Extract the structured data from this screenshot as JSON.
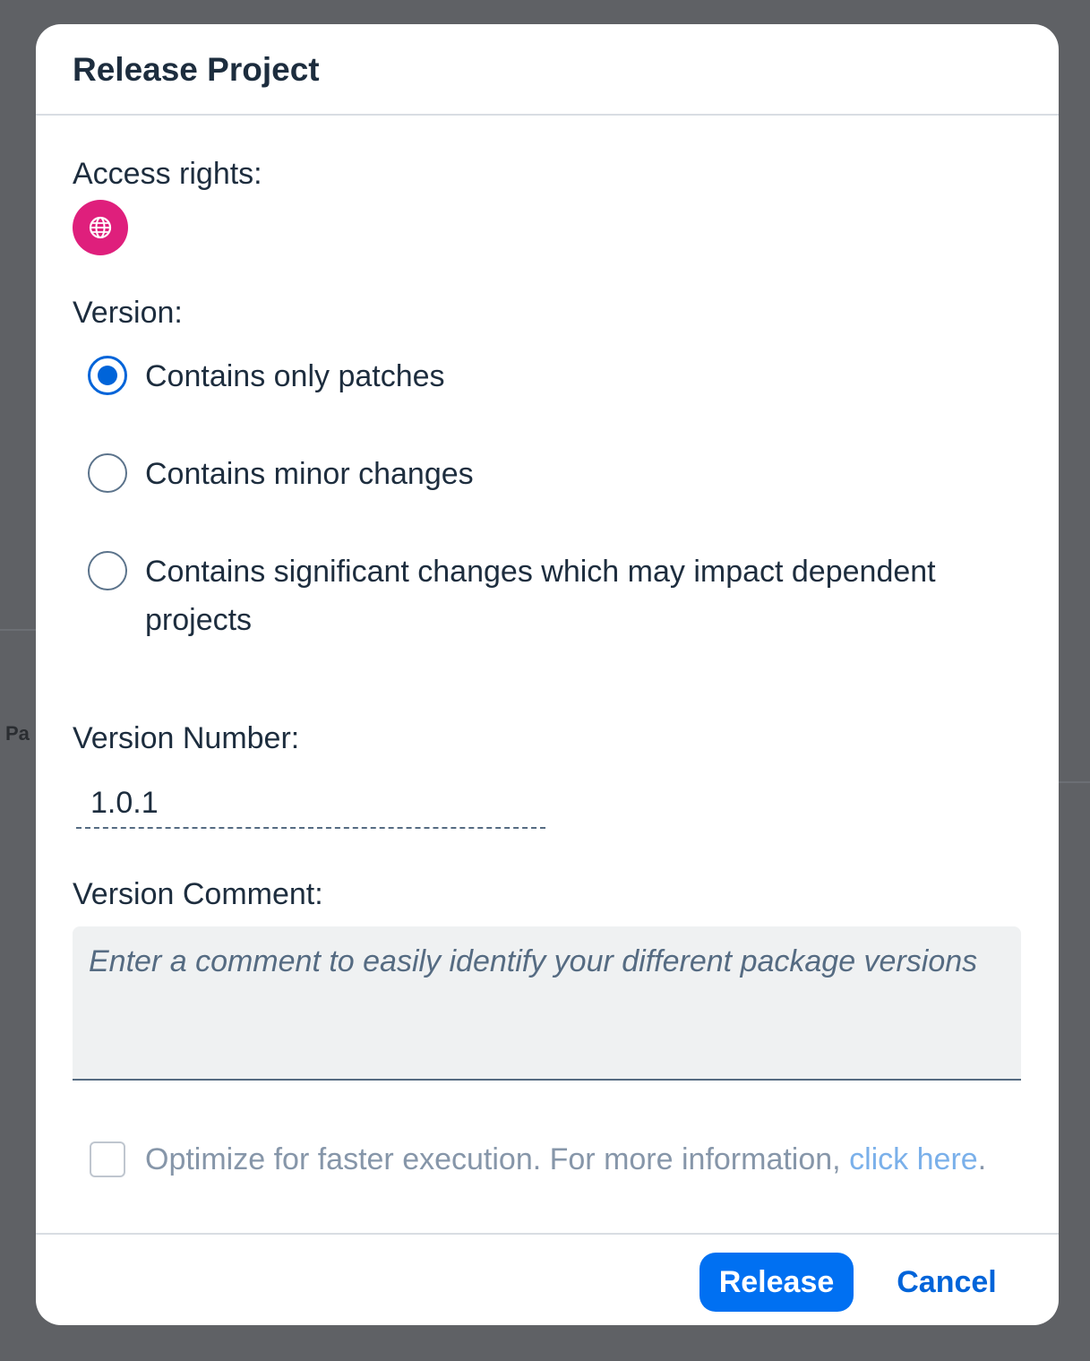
{
  "background": {
    "partial_text": "Pa"
  },
  "dialog": {
    "title": "Release Project",
    "access_rights_label": "Access rights:",
    "access_icon": "globe-icon",
    "access_icon_color": "#df1f7c",
    "version_label": "Version:",
    "version_options": [
      {
        "label": "Contains only patches",
        "selected": true
      },
      {
        "label": "Contains minor changes",
        "selected": false
      },
      {
        "label": "Contains significant changes which may impact dependent projects",
        "selected": false
      }
    ],
    "version_number_label": "Version Number:",
    "version_number_value": "1.0.1",
    "version_comment_label": "Version Comment:",
    "version_comment_placeholder": "Enter a comment to easily identify your different package versions",
    "optimize_checked": false,
    "optimize_text": "Optimize for faster execution. For more information, ",
    "optimize_link": "click here",
    "optimize_suffix": ".",
    "release_button": "Release",
    "cancel_button": "Cancel",
    "accent_color": "#0070f2"
  }
}
